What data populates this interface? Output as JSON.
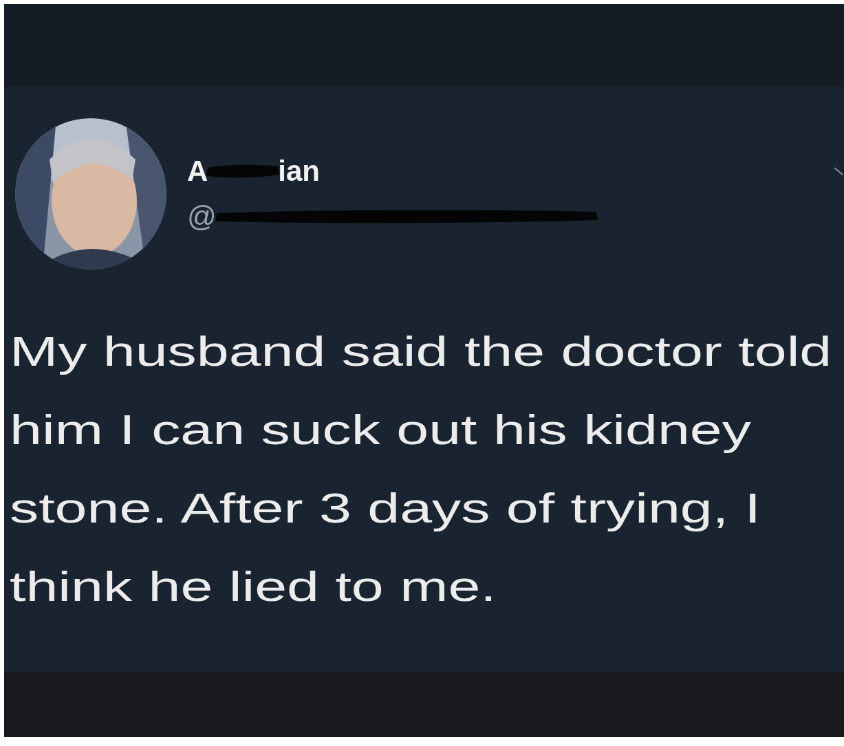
{
  "tweet": {
    "avatar": {
      "kind": "picture"
    },
    "name_fragments": [
      "A",
      "ian"
    ],
    "handle_fragments": [
      "@"
    ],
    "text_lines": [
      "My husband said the doctor told",
      "him I can suck out his kidney",
      "stone. After 3 days of trying, I",
      "think he lied to me."
    ]
  }
}
